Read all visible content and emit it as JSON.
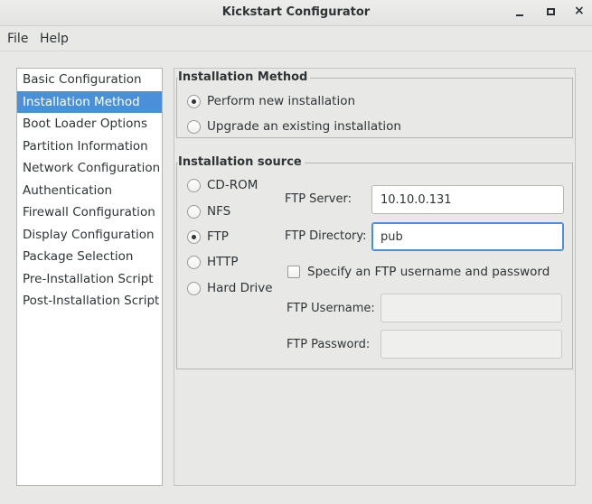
{
  "window": {
    "title": "Kickstart Configurator",
    "controls": {
      "minimize": "_",
      "maximize": "□",
      "close": "×"
    }
  },
  "menu": {
    "items": [
      {
        "label": "File"
      },
      {
        "label": "Help"
      }
    ]
  },
  "sidebar": {
    "selected_index": 1,
    "items": [
      {
        "label": "Basic Configuration"
      },
      {
        "label": "Installation Method"
      },
      {
        "label": "Boot Loader Options"
      },
      {
        "label": "Partition Information"
      },
      {
        "label": "Network Configuration"
      },
      {
        "label": "Authentication"
      },
      {
        "label": "Firewall Configuration"
      },
      {
        "label": "Display Configuration"
      },
      {
        "label": "Package Selection"
      },
      {
        "label": "Pre-Installation Script"
      },
      {
        "label": "Post-Installation Script"
      }
    ]
  },
  "installation_method": {
    "title": "Installation Method",
    "options": [
      {
        "label": "Perform new installation",
        "checked": true
      },
      {
        "label": "Upgrade an existing installation",
        "checked": false
      }
    ]
  },
  "installation_source": {
    "title": "Installation source",
    "options": [
      {
        "label": "CD-ROM",
        "checked": false
      },
      {
        "label": "NFS",
        "checked": false
      },
      {
        "label": "FTP",
        "checked": true
      },
      {
        "label": "HTTP",
        "checked": false
      },
      {
        "label": "Hard Drive",
        "checked": false
      }
    ],
    "ftp": {
      "server_label": "FTP Server:",
      "server_value": "10.10.0.131",
      "directory_label": "FTP Directory:",
      "directory_value": "pub",
      "auth_checkbox_label": "Specify an FTP username and password",
      "auth_checked": false,
      "username_label": "FTP Username:",
      "username_value": "",
      "password_label": "FTP Password:",
      "password_value": ""
    }
  },
  "colors": {
    "selection": "#4a90d9",
    "background": "#e8e8e7",
    "text": "#2e3436"
  }
}
